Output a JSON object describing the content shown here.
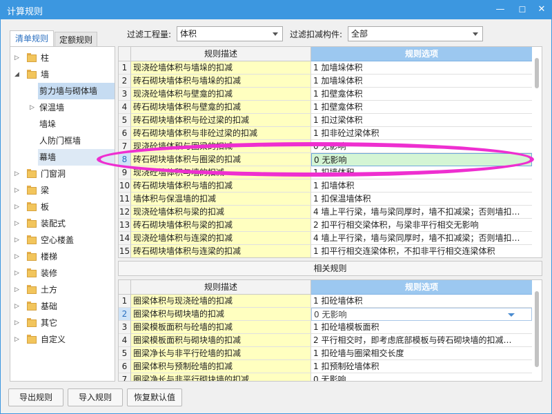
{
  "window": {
    "title": "计算规则",
    "minimize": "—",
    "maximize": "☐",
    "close": "✕"
  },
  "tabs": [
    {
      "label": "清单规则",
      "active": true
    },
    {
      "label": "定额规则",
      "active": false
    }
  ],
  "tree": [
    {
      "label": "柱",
      "level": 0,
      "arrow": "▷"
    },
    {
      "label": "墙",
      "level": 0,
      "arrow": "◢"
    },
    {
      "label": "剪力墙与砌体墙",
      "level": 1,
      "arrow": ""
    },
    {
      "label": "保温墙",
      "level": 1,
      "arrow": "▷"
    },
    {
      "label": "墙垛",
      "level": 1,
      "arrow": ""
    },
    {
      "label": "人防门框墙",
      "level": 1,
      "arrow": ""
    },
    {
      "label": "幕墙",
      "level": 1,
      "arrow": ""
    },
    {
      "label": "门窗洞",
      "level": 0,
      "arrow": "▷"
    },
    {
      "label": "梁",
      "level": 0,
      "arrow": "▷"
    },
    {
      "label": "板",
      "level": 0,
      "arrow": "▷"
    },
    {
      "label": "装配式",
      "level": 0,
      "arrow": "▷"
    },
    {
      "label": "空心楼盖",
      "level": 0,
      "arrow": "▷"
    },
    {
      "label": "楼梯",
      "level": 0,
      "arrow": "▷"
    },
    {
      "label": "装修",
      "level": 0,
      "arrow": "▷"
    },
    {
      "label": "土方",
      "level": 0,
      "arrow": "▷"
    },
    {
      "label": "基础",
      "level": 0,
      "arrow": "▷"
    },
    {
      "label": "其它",
      "level": 0,
      "arrow": "▷"
    },
    {
      "label": "自定义",
      "level": 0,
      "arrow": "▷"
    }
  ],
  "filters": {
    "quantity_label": "过滤工程量:",
    "quantity_value": "体积",
    "component_label": "过滤扣减构件:",
    "component_value": "全部"
  },
  "main_grid": {
    "headers": {
      "desc": "规则描述",
      "option": "规则选项"
    },
    "rows": [
      {
        "n": "1",
        "desc": "现浇砼墙体积与墙垛的扣减",
        "option": "1   加墙垛体积"
      },
      {
        "n": "2",
        "desc": "砖石砌块墙体积与墙垛的扣减",
        "option": "1   加墙垛体积"
      },
      {
        "n": "3",
        "desc": "现浇砼墙体积与壁龛的扣减",
        "option": "1   扣壁龛体积"
      },
      {
        "n": "4",
        "desc": "砖石砌块墙体积与壁龛的扣减",
        "option": "1   扣壁龛体积"
      },
      {
        "n": "5",
        "desc": "砖石砌块墙体积与砼过梁的扣减",
        "option": "1   扣过梁体积"
      },
      {
        "n": "6",
        "desc": "砖石砌块墙体积与非砼过梁的扣减",
        "option": "1   扣非砼过梁体积"
      },
      {
        "n": "7",
        "desc": "现浇砼墙体积与圈梁的扣减",
        "option": "0   无影响"
      },
      {
        "n": "8",
        "desc": "砖石砌块墙体积与圈梁的扣减",
        "option": "0   无影响"
      },
      {
        "n": "9",
        "desc": "现浇砼墙体积与墙的扣减",
        "option": "1   扣墙体积"
      },
      {
        "n": "10",
        "desc": "砖石砌块墙体积与墙的扣减",
        "option": "1   扣墙体积"
      },
      {
        "n": "11",
        "desc": "墙体积与保温墙的扣减",
        "option": "1   扣保温墙体积"
      },
      {
        "n": "12",
        "desc": "现浇砼墙体积与梁的扣减",
        "option": "4   墙上平行梁，墙与梁同厚时，墙不扣减梁；否则墙扣…"
      },
      {
        "n": "13",
        "desc": "砖石砌块墙体积与梁的扣减",
        "option": "2   扣平行相交梁体积，与梁非平行相交无影响"
      },
      {
        "n": "14",
        "desc": "现浇砼墙体积与连梁的扣减",
        "option": "4   墙上平行梁，墙与梁同厚时，墙不扣减梁；否则墙扣…"
      },
      {
        "n": "15",
        "desc": "砖石砌块墙体积与连梁的扣减",
        "option": "1   扣平行相交连梁体积，不扣非平行相交连梁体积"
      }
    ]
  },
  "related_label": "相关规则",
  "sub_grid": {
    "headers": {
      "desc": "规则描述",
      "option": "规则选项"
    },
    "rows": [
      {
        "n": "1",
        "desc": "圈梁体积与现浇砼墙的扣减",
        "option": "1 扣砼墙体积"
      },
      {
        "n": "2",
        "desc": "圈梁体积与砌块墙的扣减",
        "option": "0   无影响"
      },
      {
        "n": "3",
        "desc": "圈梁模板面积与砼墙的扣减",
        "option": "1 扣砼墙模板面积"
      },
      {
        "n": "4",
        "desc": "圈梁模板面积与砌块墙的扣减",
        "option": "2 平行相交时，即考虑底部模板与砖石砌块墙的扣减…"
      },
      {
        "n": "5",
        "desc": "圈梁净长与非平行砼墙的扣减",
        "option": "1 扣砼墙与圈梁相交长度"
      },
      {
        "n": "6",
        "desc": "圈梁体积与预制砼墙的扣减",
        "option": "1 扣预制砼墙体积"
      },
      {
        "n": "7",
        "desc": "圈梁净长与非平行砌块墙的扣减",
        "option": "0   无影响"
      }
    ]
  },
  "buttons": {
    "export": "导出规则",
    "import": "导入规则",
    "restore": "恢复默认值"
  },
  "colors": {
    "title_bar": "#3c97e0",
    "highlight_ellipse": "#ee2fd0",
    "desc_cell": "#ffffc0",
    "selected_option": "#d4f5d4"
  }
}
